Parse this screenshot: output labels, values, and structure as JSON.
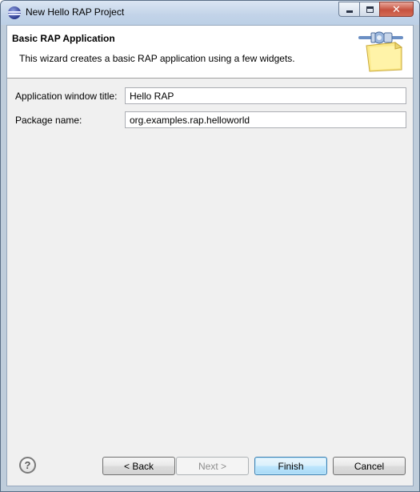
{
  "window": {
    "title": "New Hello RAP Project",
    "controls": {
      "minimize": "minimize",
      "maximize": "maximize",
      "close": "✕"
    }
  },
  "banner": {
    "title": "Basic RAP Application",
    "description": "This wizard creates a basic RAP application using a few widgets."
  },
  "form": {
    "window_title_label": "Application window title:",
    "window_title_value": "Hello RAP",
    "package_label": "Package name:",
    "package_value": "org.examples.rap.helloworld"
  },
  "buttons": {
    "help": "?",
    "back": "< Back",
    "next": "Next >",
    "finish": "Finish",
    "cancel": "Cancel"
  },
  "icons": {
    "app": "eclipse-icon",
    "banner": "plugin-wizard-icon",
    "help": "help-icon"
  },
  "colors": {
    "default_button_border": "#3c7fb1",
    "close_button": "#c6523f",
    "dialog_background": "#f0f0f0"
  }
}
